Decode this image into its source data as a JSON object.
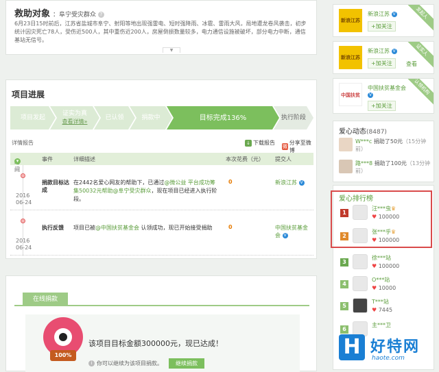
{
  "rescue": {
    "title": "救助对象",
    "subtitle": "：阜宁受灾群众",
    "description": "6月23日15时前后，江苏省盐城市阜宁、射阳等地出现强雷电、短时强降雨、冰雹、雷雨大风，局地遭龙卷风袭击，初步统计因灾死亡78人，受伤近500人，其中重伤近200人，房屋倒损数量较多，电力通信设施被破坏，部分电力中断，通信基站无信号。"
  },
  "progress": {
    "title": "项目进展",
    "steps": [
      {
        "label": "项目发起",
        "sub": ""
      },
      {
        "label": "证实为真",
        "sub": "查看详情»"
      },
      {
        "label": "已认领",
        "sub": ""
      },
      {
        "label": "捐款中",
        "sub": ""
      },
      {
        "label": "目标完成136%",
        "sub": ""
      },
      {
        "label": "执行阶段",
        "sub": ""
      }
    ],
    "report_label": "详情报告",
    "download_label": "下载报告",
    "share_label": "分享至微博",
    "columns": [
      "时间",
      "事件",
      "详细描述",
      "本次花费（元）",
      "提交人"
    ],
    "rows": [
      {
        "year": "2016",
        "date": "06-24",
        "event": "捐款目标达成",
        "detail_pre": "在2442名爱心网友的帮助下，已通过",
        "detail_hl": "@微公益 平台成功筹集50032元帮助@阜宁受灾群众",
        "detail_post": "，现在项目已经进入执行阶段。",
        "cost": "0",
        "submitter": "新浪江苏"
      },
      {
        "year": "2016",
        "date": "06-24",
        "event": "执行反馈",
        "detail_pre": "项目已被",
        "detail_hl": "@中国扶贫基金会",
        "detail_post": " 认领成功，现已开始接受捐助",
        "cost": "0",
        "submitter": "中国扶贫基金会"
      }
    ]
  },
  "donate": {
    "tab": "在线捐款",
    "badge": "100%",
    "reached": "该项目目标金额300000元，现已达成！",
    "note": "你可以继续为该项目捐款。",
    "continue_button": "继续捐款"
  },
  "orgs": [
    {
      "logo": "新浪江苏",
      "name": "新浪江苏",
      "follow": "+加关注",
      "view": "",
      "corner": "发起人"
    },
    {
      "logo": "新浪江苏",
      "name": "新浪江苏",
      "follow": "+加关注",
      "view": "查看",
      "corner": "证实人"
    },
    {
      "logo": "中国扶贫",
      "name": "中国扶贫基金会",
      "follow": "+加关注",
      "view": "",
      "corner": "认领机构"
    }
  ],
  "dynamic": {
    "title": "爱心动态",
    "count": "(8487)",
    "items": [
      {
        "user": "W***c",
        "action": " 捐助了50元",
        "time": "（15分钟前）"
      },
      {
        "user": "路***8",
        "action": " 捐助了100元",
        "time": "（13分钟前）"
      }
    ]
  },
  "rank": {
    "title": "爱心排行榜",
    "items": [
      {
        "num": "1",
        "name": "汪***虫",
        "score": "100000",
        "color": "#c0392b"
      },
      {
        "num": "2",
        "name": "张***乎",
        "score": "100000",
        "color": "#e08a2c"
      },
      {
        "num": "3",
        "name": "徐***站",
        "score": "100000",
        "color": "#6aa84f"
      },
      {
        "num": "4",
        "name": "O***站",
        "score": "10000",
        "color": "#8cbf6e"
      },
      {
        "num": "5",
        "name": "T***站",
        "score": "7445",
        "color": "#8cbf6e"
      },
      {
        "num": "6",
        "name": "主***卫",
        "score": "",
        "color": "#8cbf6e"
      }
    ]
  },
  "watermark": {
    "logo": "H",
    "text": "好特网",
    "url": "haote.com"
  },
  "colors": {
    "accent": "#7cbf5d",
    "link": "#5a9c3a",
    "highlight_box": "#d94a4a"
  }
}
